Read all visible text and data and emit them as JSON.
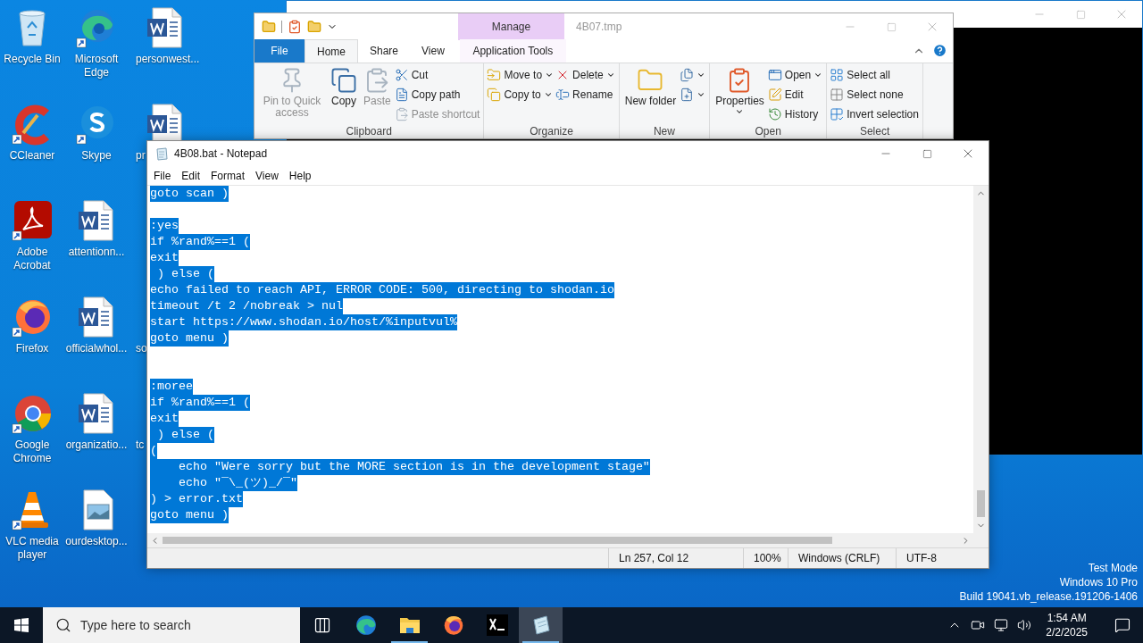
{
  "desktop": {
    "columns": [
      [
        {
          "label": "Recycle Bin",
          "kind": "recycle-bin"
        },
        {
          "label": "CCleaner",
          "kind": "ccleaner"
        },
        {
          "label": "Adobe Acrobat",
          "kind": "acrobat"
        },
        {
          "label": "Firefox",
          "kind": "firefox"
        },
        {
          "label": "Google Chrome",
          "kind": "chrome"
        },
        {
          "label": "VLC media player",
          "kind": "vlc"
        }
      ],
      [
        {
          "label": "Microsoft Edge",
          "kind": "edge"
        },
        {
          "label": "Skype",
          "kind": "skype"
        },
        {
          "label": "attentionn...",
          "kind": "word"
        },
        {
          "label": "officialwhol...",
          "kind": "word"
        },
        {
          "label": "organizatio...",
          "kind": "word"
        },
        {
          "label": "ourdesktop...",
          "kind": "image"
        }
      ],
      [
        {
          "label": "personwest...",
          "kind": "word"
        },
        {
          "label": "pr",
          "kind": "word"
        },
        {
          "label": "so",
          "kind": "covered"
        },
        {
          "label": "tc",
          "kind": "covered"
        }
      ]
    ]
  },
  "explorer": {
    "title": "4B07.tmp",
    "context_tab": "Manage",
    "tabs": [
      {
        "label": "File",
        "kind": "file",
        "selected": false
      },
      {
        "label": "Home",
        "kind": "tab",
        "selected": true
      },
      {
        "label": "Share",
        "kind": "tab",
        "selected": false
      },
      {
        "label": "View",
        "kind": "tab",
        "selected": false
      },
      {
        "label": "Application Tools",
        "kind": "tab",
        "selected": false
      }
    ],
    "groups": [
      {
        "label": "Clipboard",
        "columns": [
          {
            "kind": "large",
            "items": [
              {
                "label": "Pin to Quick access",
                "disabled": true,
                "dropdown": false
              }
            ]
          },
          {
            "kind": "large",
            "items": [
              {
                "label": "Copy",
                "disabled": false,
                "dropdown": false
              }
            ]
          },
          {
            "kind": "large",
            "items": [
              {
                "label": "Paste",
                "disabled": true,
                "dropdown": false
              }
            ]
          },
          {
            "kind": "small",
            "items": [
              {
                "label": "Cut",
                "disabled": false,
                "dropdown": false
              },
              {
                "label": "Copy path",
                "disabled": false,
                "dropdown": false
              },
              {
                "label": "Paste shortcut",
                "disabled": true,
                "dropdown": false
              }
            ]
          }
        ]
      },
      {
        "label": "Organize",
        "columns": [
          {
            "kind": "small",
            "items": [
              {
                "label": "Move to",
                "disabled": false,
                "dropdown": true
              },
              {
                "label": "Copy to",
                "disabled": false,
                "dropdown": true
              }
            ]
          },
          {
            "kind": "small",
            "items": [
              {
                "label": "Delete",
                "disabled": false,
                "dropdown": true
              },
              {
                "label": "Rename",
                "disabled": false,
                "dropdown": false
              }
            ]
          }
        ]
      },
      {
        "label": "New",
        "columns": [
          {
            "kind": "large",
            "items": [
              {
                "label": "New folder",
                "disabled": false,
                "dropdown": false
              }
            ]
          },
          {
            "kind": "small",
            "items": [
              {
                "disabled": false,
                "dropdown": true
              },
              {
                "disabled": false,
                "dropdown": true
              }
            ]
          }
        ]
      },
      {
        "label": "Open",
        "columns": [
          {
            "kind": "large",
            "items": [
              {
                "label": "Properties",
                "disabled": false,
                "dropdown": true
              }
            ]
          },
          {
            "kind": "small",
            "items": [
              {
                "label": "Open",
                "disabled": false,
                "dropdown": true
              },
              {
                "label": "Edit",
                "disabled": false,
                "dropdown": false
              },
              {
                "label": "History",
                "disabled": false,
                "dropdown": false
              }
            ]
          }
        ]
      },
      {
        "label": "Select",
        "columns": [
          {
            "kind": "small",
            "items": [
              {
                "label": "Select all",
                "disabled": false,
                "dropdown": false
              },
              {
                "label": "Select none",
                "disabled": false,
                "dropdown": false
              },
              {
                "label": "Invert selection",
                "disabled": false,
                "dropdown": false
              }
            ]
          }
        ]
      }
    ]
  },
  "notepad": {
    "title": "4B08.bat - Notepad",
    "menu": [
      "File",
      "Edit",
      "Format",
      "View",
      "Help"
    ],
    "text_selected": true,
    "lines": [
      {
        "kind": "code",
        "text": "goto scan )"
      },
      {
        "kind": "blank"
      },
      {
        "kind": "code",
        "text": ":yes"
      },
      {
        "kind": "code",
        "text": "if %rand%==1 ("
      },
      {
        "kind": "code",
        "text": "exit"
      },
      {
        "kind": "code",
        "text": " ) else ("
      },
      {
        "kind": "code",
        "text": "echo failed to reach API, ERROR CODE: 500, directing to shodan.io"
      },
      {
        "kind": "code",
        "text": "timeout /t 2 /nobreak > nul"
      },
      {
        "kind": "code",
        "text": "start https://www.shodan.io/host/%inputvul%"
      },
      {
        "kind": "code",
        "text": "goto menu )"
      },
      {
        "kind": "blank"
      },
      {
        "kind": "blank"
      },
      {
        "kind": "code",
        "text": ":moree"
      },
      {
        "kind": "code",
        "text": "if %rand%==1 ("
      },
      {
        "kind": "code",
        "text": "exit"
      },
      {
        "kind": "code",
        "text": " ) else ("
      },
      {
        "kind": "code",
        "text": "("
      },
      {
        "kind": "code",
        "text": "    echo \"Were sorry but the MORE section is in the development stage\""
      },
      {
        "kind": "code",
        "text": "    echo \"¯\\_(ツ)_/¯\""
      },
      {
        "kind": "code",
        "text": ") > error.txt"
      },
      {
        "kind": "code",
        "text": "goto menu )"
      }
    ],
    "status": [
      "Ln 257, Col 12",
      "100%",
      "Windows (CRLF)",
      "UTF-8"
    ]
  },
  "system_info": [
    "Test Mode",
    "Windows 10 Pro",
    "Build 19041.vb_release.191206-1406"
  ],
  "taskbar": {
    "search": {
      "placeholder": "Type here to search"
    },
    "apps": [
      {
        "kind": "task-view",
        "running": false,
        "selected": false
      },
      {
        "kind": "edge",
        "running": false,
        "selected": false
      },
      {
        "kind": "explorer",
        "running": true,
        "selected": false
      },
      {
        "kind": "firefox",
        "running": false,
        "selected": false
      },
      {
        "kind": "terminal",
        "running": false,
        "selected": false
      },
      {
        "kind": "notepad",
        "running": true,
        "selected": true
      }
    ],
    "time": "1:54 AM",
    "date": "2/2/2025"
  }
}
